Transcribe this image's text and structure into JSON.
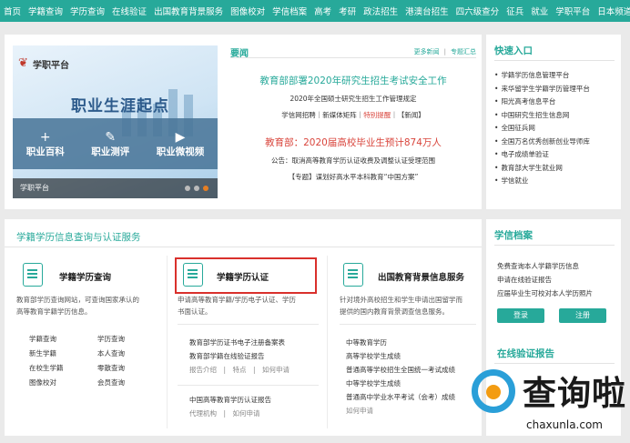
{
  "nav": [
    "首页",
    "学籍查询",
    "学历查询",
    "在线验证",
    "出国教育背景服务",
    "图像校对",
    "学信档案",
    "高考",
    "考研",
    "政法招生",
    "港澳台招生",
    "四六级查分",
    "征兵",
    "就业",
    "学职平台",
    "日本频道"
  ],
  "banner": {
    "logo": "学职平台",
    "title": "职业生涯起点",
    "items": [
      {
        "icon": "+",
        "label": "职业百科"
      },
      {
        "icon": "✎",
        "label": "职业测评"
      },
      {
        "icon": "▶",
        "label": "职业微视频"
      }
    ],
    "footer": "学职平台"
  },
  "news": {
    "title": "要闻",
    "more": "更多新闻",
    "topic": "专题汇总",
    "headline1": "教育部部署2020年研究生招生考试安全工作",
    "sub1": "2020年全国硕士研究生招生工作管理规定",
    "sub2_a": "学信网招聘｜新媒体矩阵｜",
    "sub2_b": "特别提醒",
    "sub2_c": "｜【新闻】",
    "headline2": "教育部：2020届高校毕业生预计874万人",
    "sub3": "公告：取消高等教育学历认证收费及调整认证受理范围",
    "sub4": "【专题】谋划好高水平本科教育“中国方案”"
  },
  "quick": {
    "title": "快速入口",
    "items": [
      "学籍学历信息管理平台",
      "来华留学生学籍学历管理平台",
      "阳光高考信息平台",
      "中国研究生招生信息网",
      "全国征兵网",
      "全国万名优秀创新创业导师库",
      "电子成绩单验证",
      "教育部大学生就业网",
      "学信就业"
    ]
  },
  "services": {
    "title": "学籍学历信息查询与认证服务",
    "col1": {
      "name": "学籍学历查询",
      "desc1": "教育部学历查询网站，可查询国家承认的",
      "desc2": "高等教育学籍学历信息。",
      "links": [
        [
          "学籍查询",
          "学历查询"
        ],
        [
          "新生学籍",
          "本人查询"
        ],
        [
          "在校生学籍",
          "零散查询"
        ],
        [
          "图像校对",
          "会员查询"
        ]
      ]
    },
    "col2": {
      "name": "学籍学历认证",
      "desc1": "申请高等教育学籍/学历电子认证、学历",
      "desc2": "书面认证。",
      "links1": [
        "教育部学历证书电子注册备案表",
        "教育部学籍在线验证报告"
      ],
      "sub1": "报告介绍　|　特点　|　如何申请",
      "links2": [
        "中国高等教育学历认证报告"
      ],
      "sub2": "代理机构　|　如何申请"
    },
    "col3": {
      "name": "出国教育背景信息服务",
      "desc1": "针对境外高校招生和学生申请出国留学而",
      "desc2": "提供的国内教育背景调查信息服务。",
      "links": [
        "中等教育学历",
        "高等学校学生成绩",
        "普通高等学校招生全国统一考试成绩",
        "中等学校学生成绩",
        "普通高中学业水平考试（会考）成绩"
      ],
      "sub": "如何申请"
    }
  },
  "xueli": {
    "title": "学信档案",
    "lines": [
      "免费查询本人学籍学历信息",
      "申请在线验证报告",
      "应届毕业生可校对本人学历照片"
    ],
    "login": "登录",
    "register": "注册",
    "verify_title": "在线验证报告"
  },
  "watermark": {
    "text": "查询啦",
    "domain": "chaxunla.com"
  }
}
